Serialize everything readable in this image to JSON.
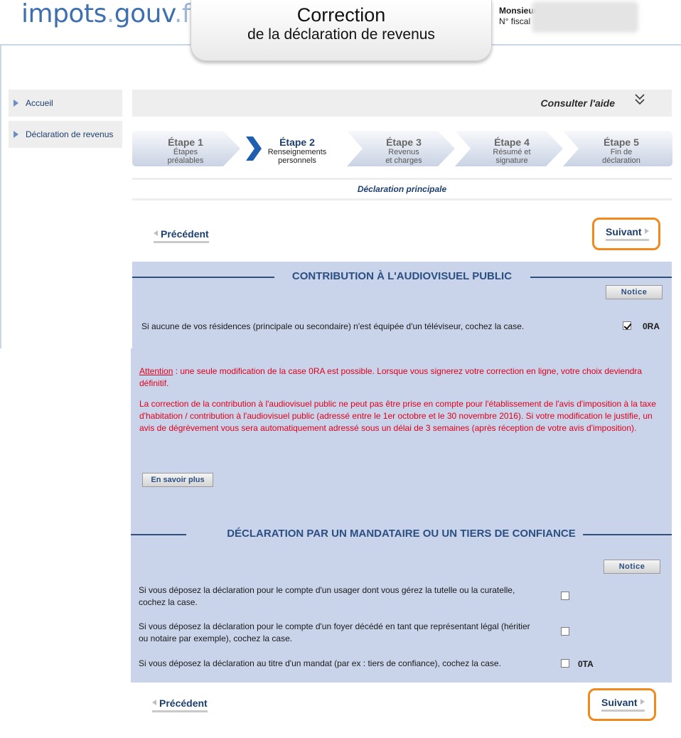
{
  "header": {
    "logo_main": "impots",
    "logo_dot": ".",
    "logo_gouv": "gouv",
    "logo_fr": ".fr",
    "title_line1": "Correction",
    "title_line2": "de la déclaration de revenus",
    "user_line1": "Monsieur",
    "user_line2": "N° fiscal"
  },
  "sidebar": {
    "items": [
      {
        "label": "Accueil"
      },
      {
        "label": "Déclaration de revenus"
      }
    ]
  },
  "help": {
    "label": "Consulter l'aide",
    "chevron": "⌄⌄"
  },
  "steps": [
    {
      "label": "Étape 1",
      "sub1": "Étapes",
      "sub2": "préalables"
    },
    {
      "label": "Étape 2",
      "sub1": "Renseignements",
      "sub2": "personnels"
    },
    {
      "label": "Étape 3",
      "sub1": "Revenus",
      "sub2": "et charges"
    },
    {
      "label": "Étape 4",
      "sub1": "Résumé et",
      "sub2": "signature"
    },
    {
      "label": "Étape 5",
      "sub1": "Fin de",
      "sub2": "déclaration"
    }
  ],
  "active_step": 2,
  "subtitle": "Déclaration principale",
  "nav": {
    "prev": "Précédent",
    "next": "Suivant"
  },
  "audiovisuel": {
    "title": "CONTRIBUTION À L'AUDIOVISUEL PUBLIC",
    "notice": "Notice",
    "question": "Si aucune de vos résidences (principale ou secondaire) n'est équipée d'un téléviseur, cochez la case.",
    "checked": true,
    "code": "0RA",
    "attention_word": "Attention",
    "attention_text": " : une seule modification de la case 0RA est possible. Lorsque vous signerez votre correction en ligne, votre choix deviendra définitif.",
    "info_text": "La correction de la contribution à l'audiovisuel public ne peut pas être prise en compte pour l'établissement de l'avis d'imposition à la taxe d'habitation / contribution à l'audiovisuel public (adressé entre le 1er octobre et le 30 novembre 2016). Si votre modification le justifie, un avis de dégrèvement vous sera automatiquement adressé sous un délai de 3 semaines (après réception de votre avis d'imposition).",
    "more_button": "En savoir plus"
  },
  "mandataire": {
    "title": "DÉCLARATION PAR UN MANDATAIRE OU UN TIERS DE CONFIANCE",
    "notice": "Notice",
    "rows": [
      {
        "text": "Si vous déposez la déclaration pour le compte d'un usager dont vous gérez la tutelle ou la curatelle, cochez la case.",
        "code": ""
      },
      {
        "text": "Si vous déposez la déclaration pour le compte d'un foyer décédé en tant que représentant légal (héritier ou notaire par exemple), cochez la case.",
        "code": ""
      },
      {
        "text": "Si vous déposez la déclaration au titre d'un mandat (par ex : tiers de confiance), cochez la case.",
        "code": "0TA"
      }
    ]
  },
  "colors": {
    "brand_blue": "#3e6fb0",
    "panel_bg": "#c9d4ea",
    "alert_red": "#e0001b",
    "highlight_orange": "#f08a1c"
  }
}
